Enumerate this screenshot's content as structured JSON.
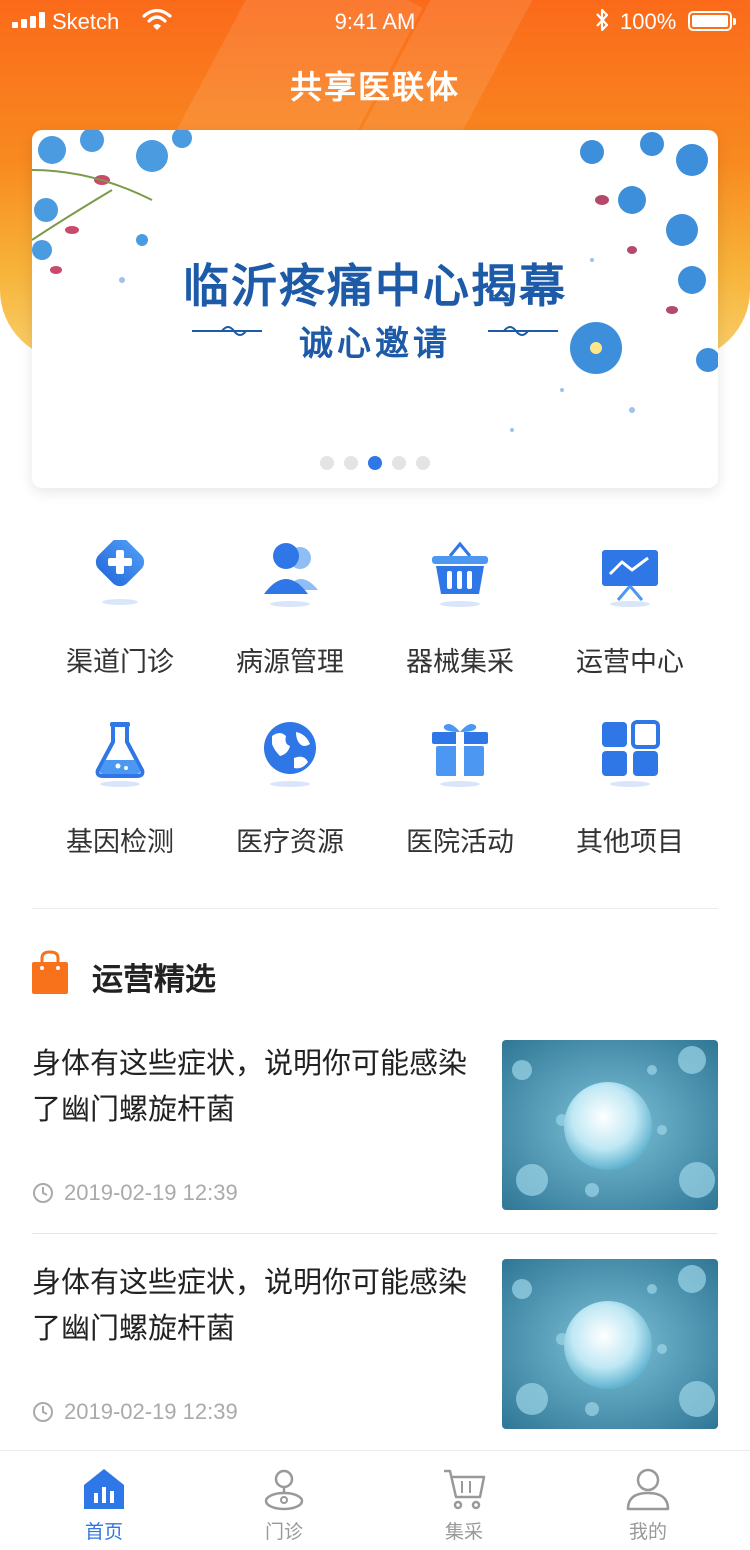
{
  "status_bar": {
    "carrier": "Sketch",
    "time": "9:41 AM",
    "battery": "100%"
  },
  "header": {
    "title": "共享医联体"
  },
  "banner": {
    "title": "临沂疼痛中心揭幕",
    "subtitle": "诚心邀请",
    "slide_count": 5,
    "active_slide": 3
  },
  "grid": {
    "items": [
      {
        "label": "渠道门诊",
        "icon": "plus-diamond-icon"
      },
      {
        "label": "病源管理",
        "icon": "users-icon"
      },
      {
        "label": "器械集采",
        "icon": "basket-icon"
      },
      {
        "label": "运营中心",
        "icon": "presentation-board-icon"
      },
      {
        "label": "基因检测",
        "icon": "flask-icon"
      },
      {
        "label": "医疗资源",
        "icon": "globe-icon"
      },
      {
        "label": "医院活动",
        "icon": "gift-icon"
      },
      {
        "label": "其他项目",
        "icon": "apps-grid-icon"
      }
    ]
  },
  "section": {
    "title": "运营精选",
    "icon": "shopping-bag-icon"
  },
  "articles": [
    {
      "title": "身体有这些症状，说明你可能感染了幽门螺旋杆菌",
      "time": "2019-02-19 12:39"
    },
    {
      "title": "身体有这些症状，说明你可能感染了幽门螺旋杆菌",
      "time": "2019-02-19 12:39"
    }
  ],
  "tabbar": {
    "tabs": [
      {
        "label": "首页",
        "icon": "home-chart-icon",
        "active": true
      },
      {
        "label": "门诊",
        "icon": "clinic-pin-icon",
        "active": false
      },
      {
        "label": "集采",
        "icon": "cart-icon",
        "active": false
      },
      {
        "label": "我的",
        "icon": "user-icon",
        "active": false
      }
    ]
  },
  "colors": {
    "accent_blue": "#2f76e6",
    "header_orange": "#fb6a1a",
    "section_icon_orange": "#f7721a"
  }
}
